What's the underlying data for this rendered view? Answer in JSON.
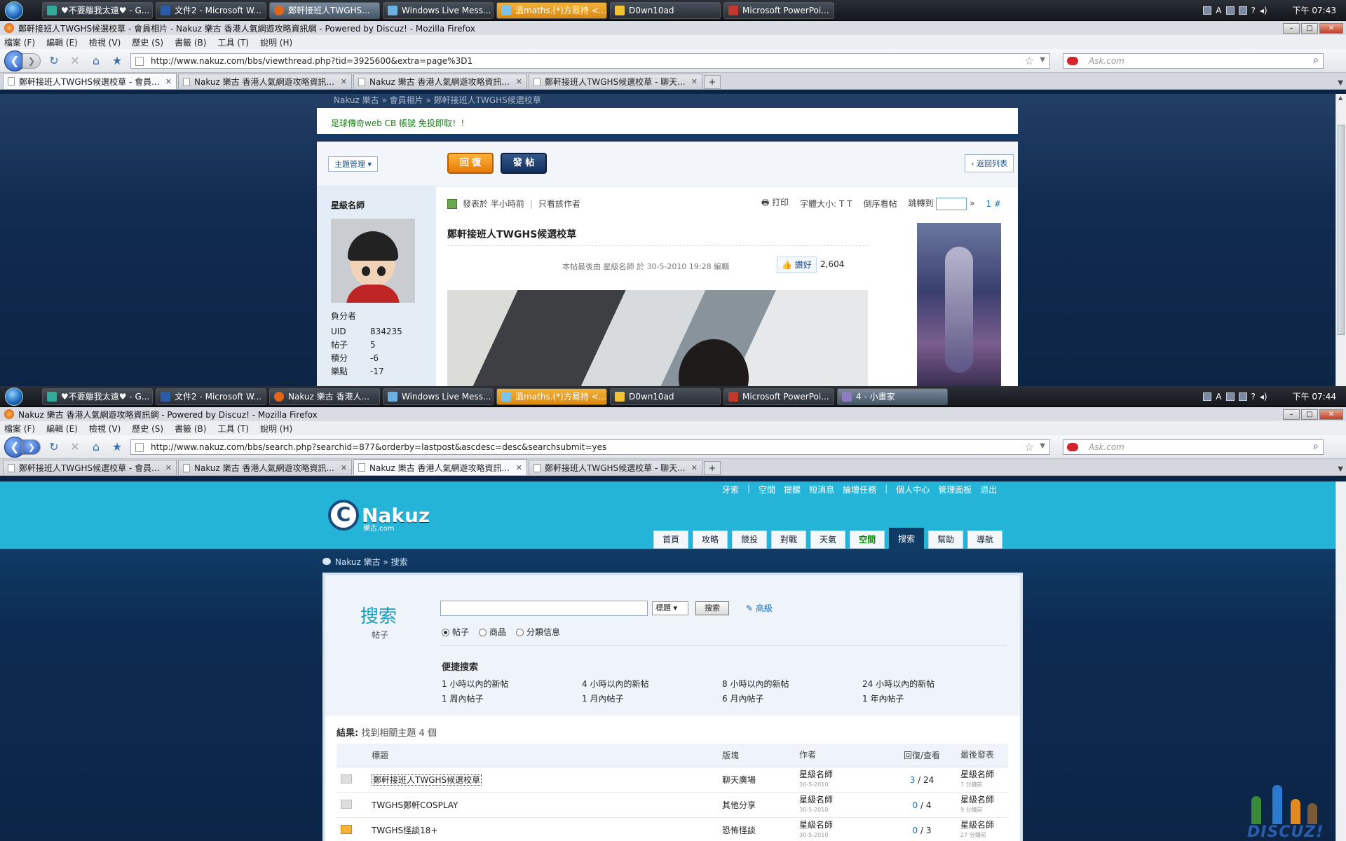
{
  "shot1": {
    "taskbar": {
      "items": [
        "♥不要離我太遠♥ - G...",
        "文件2 - Microsoft W...",
        "鄭軒接班人TWGHS...",
        "Windows Live Mess...",
        "溫maths.(*)方易持 <...",
        "D0wn10ad",
        "Microsoft PowerPoi..."
      ],
      "clock": "下午 07:43"
    },
    "window_title": "鄭軒接班人TWGHS候選校草 - 會員相片 - Nakuz 樂古 香港人氣網遊攻略資訊網 - Powered by Discuz! - Mozilla Firefox",
    "menu": [
      "檔案 (F)",
      "編輯 (E)",
      "檢視 (V)",
      "歷史 (S)",
      "書籤 (B)",
      "工具 (T)",
      "說明 (H)"
    ],
    "url": "http://www.nakuz.com/bbs/viewthread.php?tid=3925600&extra=page%3D1",
    "search_placeholder": "Ask.com",
    "tabs": [
      "鄭軒接班人TWGHS候選校草 - 會員...",
      "Nakuz 樂古 香港人氣網遊攻略資訊...",
      "Nakuz 樂古 香港人氣網遊攻略資訊...",
      "鄭軒接班人TWGHS候選校草 - 聊天..."
    ],
    "selected_tab": 0,
    "page": {
      "breadcrumb": "Nakuz 樂古 » 會員相片 » 鄭軒接班人TWGHS候選校草",
      "ad_text": "足球傳奇web CB 帳號 免投即取！！",
      "manage_btn": "主題管理 ▾",
      "reply_btn": "回 復",
      "post_btn": "發 帖",
      "back_btn": "‹ 返回列表",
      "author": "星級名師",
      "role": "負分者",
      "stats": [
        {
          "k": "UID",
          "v": "834235"
        },
        {
          "k": "帖子",
          "v": "5"
        },
        {
          "k": "積分",
          "v": "-6"
        },
        {
          "k": "樂點",
          "v": "-17"
        }
      ],
      "posted": "發表於 半小時前",
      "only_author": "只看該作者",
      "print": "打印",
      "font_size": "字體大小: T T",
      "reverse": "倒序看帖",
      "jump": "跳轉到",
      "floor": "1 #",
      "post_title": "鄭軒接班人TWGHS候選校草",
      "edit_note": "本帖最後由 星級名師 於 30-5-2010 19:28 編輯",
      "like_label": "讚好",
      "like_count": "2,604"
    }
  },
  "shot2": {
    "taskbar": {
      "items": [
        "♥不要離我太遠♥ - G...",
        "文件2 - Microsoft W...",
        "Nakuz 樂古 香港人...",
        "Windows Live Mess...",
        "溫maths.(*)方易持 <...",
        "D0wn10ad",
        "Microsoft PowerPoi...",
        "4 - 小畫家"
      ],
      "clock": "下午 07:44"
    },
    "window_title": "Nakuz 樂古 香港人氣網遊攻略資訊網 - Powered by Discuz! - Mozilla Firefox",
    "menu": [
      "檔案 (F)",
      "編輯 (E)",
      "檢視 (V)",
      "歷史 (S)",
      "書籤 (B)",
      "工具 (T)",
      "說明 (H)"
    ],
    "url": "http://www.nakuz.com/bbs/search.php?searchid=877&orderby=lastpost&ascdesc=desc&searchsubmit=yes",
    "search_placeholder": "Ask.com",
    "tabs": [
      "鄭軒接班人TWGHS候選校草 - 會員...",
      "Nakuz 樂古 香港人氣網遊攻略資訊...",
      "Nakuz 樂古 香港人氣網遊攻略資訊...",
      "鄭軒接班人TWGHS候選校草 - 聊天..."
    ],
    "selected_tab": 2,
    "page": {
      "top_links": [
        "牙索",
        "|",
        "空間",
        "提醒",
        "短消息",
        "論壇任務",
        "|",
        "個人中心",
        "管理面板",
        "退出"
      ],
      "logo": {
        "mark": "C",
        "name": "Nakuz",
        "sub": "樂古.com"
      },
      "nav": [
        "首頁",
        "攻略",
        "競投",
        "對戰",
        "天氣",
        "空間",
        "搜索",
        "幫助",
        "導航"
      ],
      "nav_highlight": 5,
      "nav_selected": 6,
      "breadcrumb": "Nakuz 樂古 » 搜索",
      "search_title": "搜索",
      "search_sub": "帖子",
      "select_value": "標題",
      "search_btn": "搜索",
      "advanced": "高級",
      "radios": [
        {
          "label": "帖子",
          "on": true
        },
        {
          "label": "商品",
          "on": false
        },
        {
          "label": "分類信息",
          "on": false
        }
      ],
      "quick_title": "便捷搜索",
      "quick_links": [
        "1 小時以內的新帖",
        "4 小時以內的新帖",
        "8 小時以內的新帖",
        "24 小時以內的新帖",
        "1 周內帖子",
        "1 月內帖子",
        "6 月內帖子",
        "1 年內帖子"
      ],
      "result_label": "結果:",
      "result_text": "找到相關主題 4 個",
      "columns": [
        "",
        "標題",
        "版塊",
        "作者",
        "回復/查看",
        "最後發表"
      ],
      "rows": [
        {
          "title": "鄭軒接班人TWGHS候選校草",
          "forum": "聊天廣場",
          "author": "星級名師",
          "date": "30-5-2010",
          "replies": "3",
          "views": "24",
          "last": "星級名師",
          "last_time": "7 分鐘前",
          "hot": false
        },
        {
          "title": "TWGHS鄭軒COSPLAY",
          "forum": "其他分享",
          "author": "星級名師",
          "date": "30-5-2010",
          "replies": "0",
          "views": "4",
          "last": "星級名師",
          "last_time": "9 分鐘前",
          "hot": false
        },
        {
          "title": "TWGHS怪談18+",
          "forum": "恐怖怪談",
          "author": "星級名師",
          "date": "30-5-2010",
          "replies": "0",
          "views": "3",
          "last": "星級名師",
          "last_time": "27 分鐘前",
          "hot": true
        }
      ],
      "watermark": "DISCUZ!"
    }
  },
  "colors": {
    "accent": "#1d9bbf",
    "header": "#24b4d8",
    "dark": "#0c2547",
    "reply": "#e47a05"
  }
}
